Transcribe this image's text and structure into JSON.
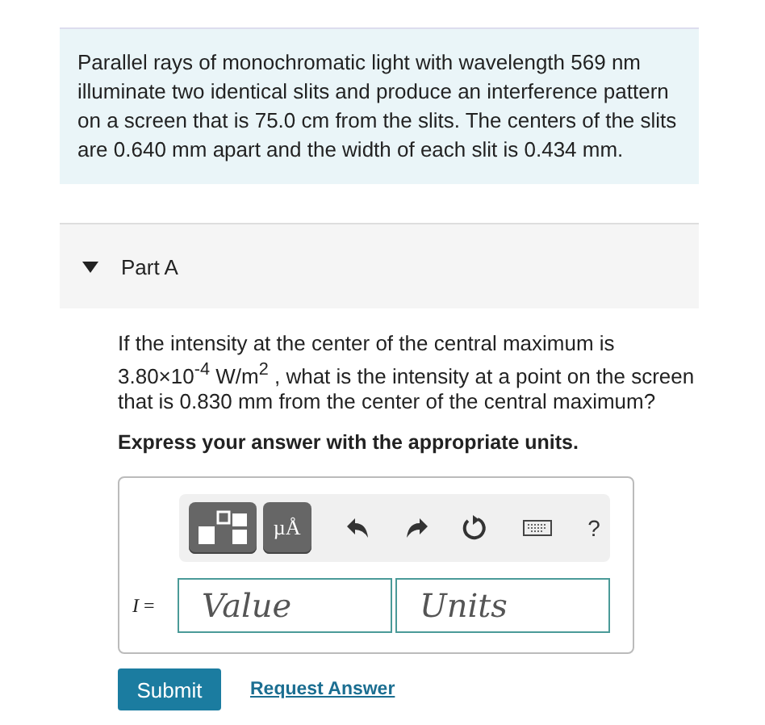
{
  "intro": "Parallel rays of monochromatic light with wavelength 569 nm illuminate two identical slits and produce an interference pattern on a screen that is 75.0 cm from the slits. The centers of the slits are 0.640 mm apart and the width of each slit is 0.434 mm.",
  "part": {
    "title": "Part A",
    "expanded": true
  },
  "question": "If the intensity at the center of the central maximum is 3.80×10$^{-4}$ W/m$^{2}$ , what is the intensity at a point on the screen that is 0.830 mm from the center of the central maximum?",
  "instruction": "Express your answer with the appropriate units.",
  "toolbar": {
    "units_label": "µÅ",
    "help": "?"
  },
  "answer": {
    "label": "*I* =",
    "value_placeholder": "Value",
    "units_placeholder": "Units"
  },
  "buttons": {
    "submit": "Submit",
    "request": "Request Answer"
  }
}
